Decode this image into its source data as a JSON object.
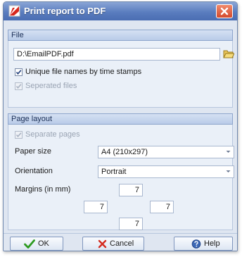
{
  "window": {
    "title": "Print report to PDF"
  },
  "file_section": {
    "header": "File",
    "path_value": "D:\\EmailPDF.pdf",
    "unique_names": {
      "label": "Unique file names by time stamps",
      "checked": true
    },
    "separated_files": {
      "label": "Seperated files",
      "checked": true,
      "enabled": false
    }
  },
  "layout_section": {
    "header": "Page layout",
    "separate_pages": {
      "label": "Separate pages",
      "checked": true,
      "enabled": false
    },
    "paper_size": {
      "label": "Paper size",
      "value": "A4 (210x297)"
    },
    "orientation": {
      "label": "Orientation",
      "value": "Portrait"
    },
    "margins": {
      "label": "Margins (in mm)",
      "top": "7",
      "left": "7",
      "right": "7",
      "bottom": "7"
    }
  },
  "buttons": {
    "ok": "OK",
    "cancel": "Cancel",
    "help": "Help"
  },
  "colors": {
    "title_bar": "#5a7dbf",
    "ok_check": "#2c9a1f",
    "cancel_x": "#d42a1f",
    "help_icon": "#3b67b5"
  },
  "icons": {
    "app": "pdf-document-icon",
    "close": "close-icon",
    "folder": "folder-open-icon",
    "ok": "checkmark-icon",
    "cancel": "x-icon",
    "help": "help-icon"
  }
}
